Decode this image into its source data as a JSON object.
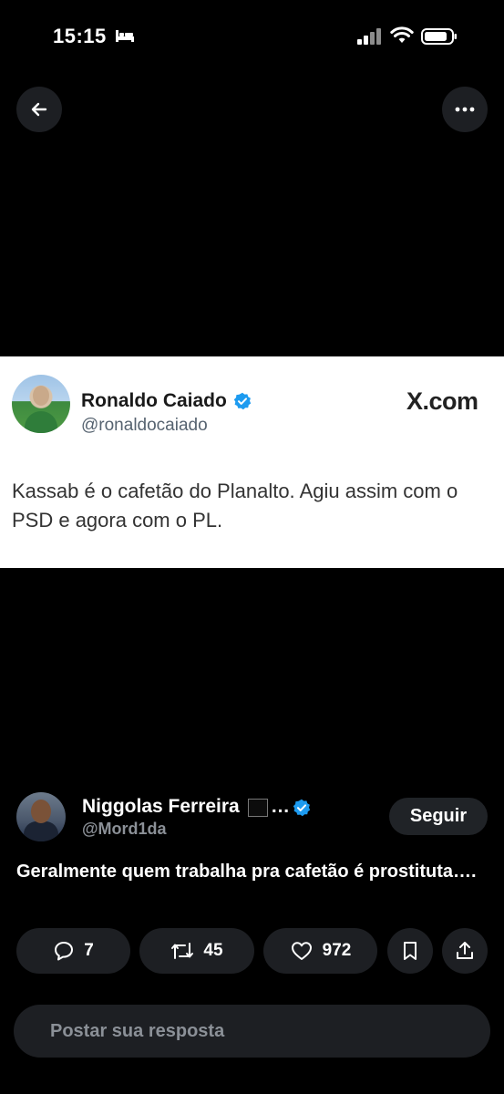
{
  "status_bar": {
    "time": "15:15",
    "icons": [
      "sleep-bed-icon",
      "cellular-signal-icon",
      "wifi-icon",
      "battery-icon"
    ]
  },
  "nav": {
    "back_icon": "arrow-left-icon",
    "more_icon": "more-horizontal-icon"
  },
  "embedded_post": {
    "author_name": "Ronaldo Caiado",
    "author_handle": "@ronaldocaiado",
    "source": "X.com",
    "text": "Kassab é o cafetão do Planalto. Agiu assim com o PSD e agora com o PL."
  },
  "post": {
    "author_name": "Niggolas Ferreira",
    "author_name_suffix": "…",
    "author_handle": "@Mord1da",
    "follow_label": "Seguir",
    "text": "Geralmente quem trabalha pra cafetão é prostituta…."
  },
  "actions": {
    "replies": "7",
    "reposts": "45",
    "likes": "972"
  },
  "reply_box": {
    "placeholder": "Postar sua resposta"
  },
  "colors": {
    "background": "#000000",
    "pill": "#1d1f23",
    "verified": "#1d9bf0",
    "muted_text": "#8b9097"
  }
}
